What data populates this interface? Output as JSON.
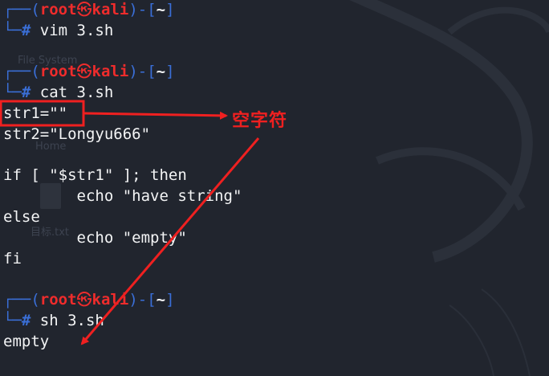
{
  "prompt": {
    "corner_top": "┌──(",
    "user": "root",
    "skull": "㉿",
    "host": "kali",
    "mid": ")-[",
    "dir": "~",
    "end": "]",
    "corner_bottom": "└─",
    "hash": "#"
  },
  "terminal": {
    "cmd1": "vim 3.sh",
    "cmd2": "cat 3.sh",
    "script_lines": [
      "str1=\"\"",
      "str2=\"Longyu666\"",
      "",
      "if [ \"$str1\" ]; then",
      "        echo \"have string\"",
      "else",
      "        echo \"empty\"",
      "fi"
    ],
    "cmd3": "sh 3.sh",
    "output": "empty"
  },
  "desktop": {
    "icon_labels": [
      "File System",
      "Home",
      "目标.txt"
    ]
  },
  "annotation": {
    "label": "空字符",
    "color": "#ef2020"
  }
}
